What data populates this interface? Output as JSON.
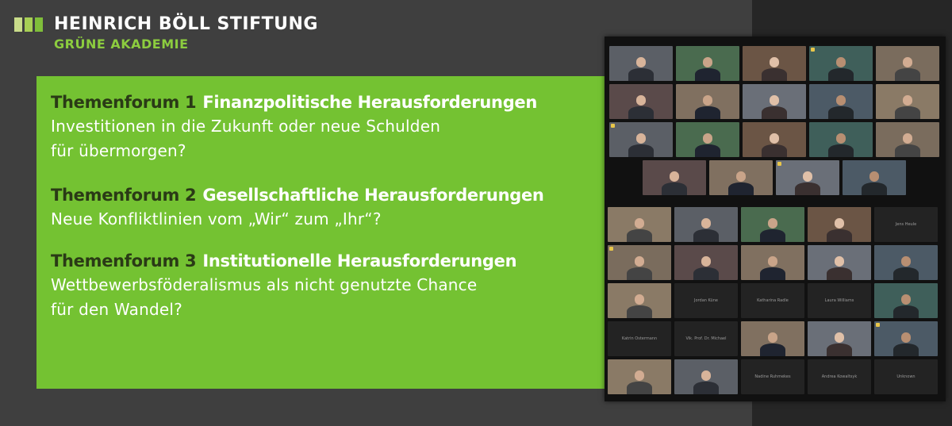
{
  "logo": {
    "title": "HEINRICH BÖLL STIFTUNG",
    "subtitle": "GRÜNE AKADEMIE",
    "bar_colors": [
      "#c9dc8a",
      "#a7cf55",
      "#7fbe3a"
    ]
  },
  "colors": {
    "panel_green": "#74c232",
    "label_dark": "#2a3a16",
    "slide_bg": "#3f3f3f"
  },
  "forums": [
    {
      "label": "Themenforum 1",
      "title": "Finanzpolitische Herausforderungen",
      "question_lines": [
        "Investitionen in die Zukunft oder neue Schulden",
        "für übermorgen?"
      ]
    },
    {
      "label": "Themenforum 2",
      "title": "Gesellschaftliche Herausforderungen",
      "question_lines": [
        "Neue Konfliktlinien vom „Wir“ zum „Ihr“?"
      ]
    },
    {
      "label": "Themenforum 3",
      "title": "Institutionelle Herausforderungen",
      "question_lines": [
        "Wettbewerbsföderalismus als nicht genutzte Chance",
        "für den Wandel?"
      ]
    }
  ],
  "participants": {
    "names": [
      "Jens Heule",
      "Jordan Küne",
      "Katharina Radle",
      "Laura Williams",
      "Katrin Ostermann",
      "Vik. Prof. Dr. Michael",
      "Nadine Ruhmekes",
      "Andrea Kowaltsyk",
      "Unknown"
    ]
  }
}
